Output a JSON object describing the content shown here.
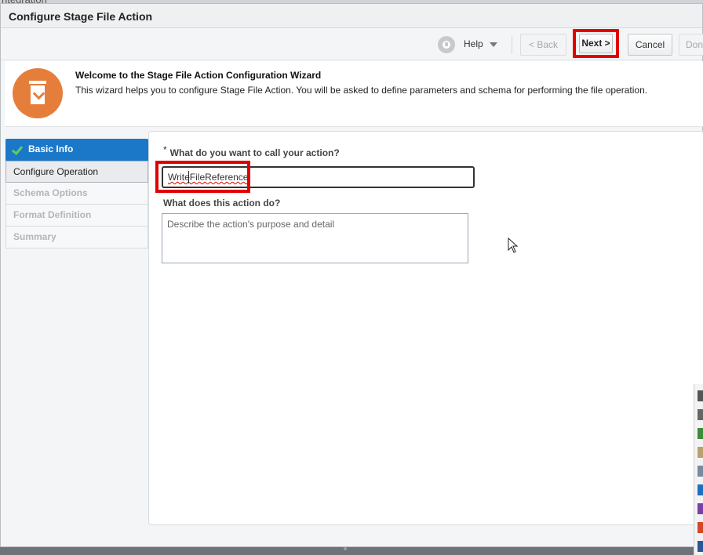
{
  "background": {
    "app_title_partial": "ntegration"
  },
  "dialog": {
    "title": "Configure Stage File Action"
  },
  "toolbar": {
    "help_label": "Help",
    "back_label": "< Back",
    "next_label": "Next >",
    "cancel_label": "Cancel",
    "done_label": "Done"
  },
  "welcome": {
    "heading": "Welcome to the Stage File Action Configuration Wizard",
    "description": "This wizard helps you to configure Stage File Action. You will be asked to define parameters and schema for performing the file operation."
  },
  "steps": [
    {
      "label": "Basic Info",
      "state": "completed"
    },
    {
      "label": "Configure Operation",
      "state": "current"
    },
    {
      "label": "Schema Options",
      "state": "disabled"
    },
    {
      "label": "Format Definition",
      "state": "disabled"
    },
    {
      "label": "Summary",
      "state": "disabled"
    }
  ],
  "form": {
    "name_required_marker": "*",
    "name_label": "What do you want to call your action?",
    "name_value_part1": "Write",
    "name_value_part2": "FileReference",
    "description_label": "What does this action do?",
    "description_placeholder": "Describe the action's purpose and detail",
    "description_value": ""
  },
  "colors": {
    "accent_blue": "#1b78c8",
    "highlight_red": "#e00000",
    "wizard_orange": "#e67e3b",
    "check_green": "#5ad05a"
  }
}
